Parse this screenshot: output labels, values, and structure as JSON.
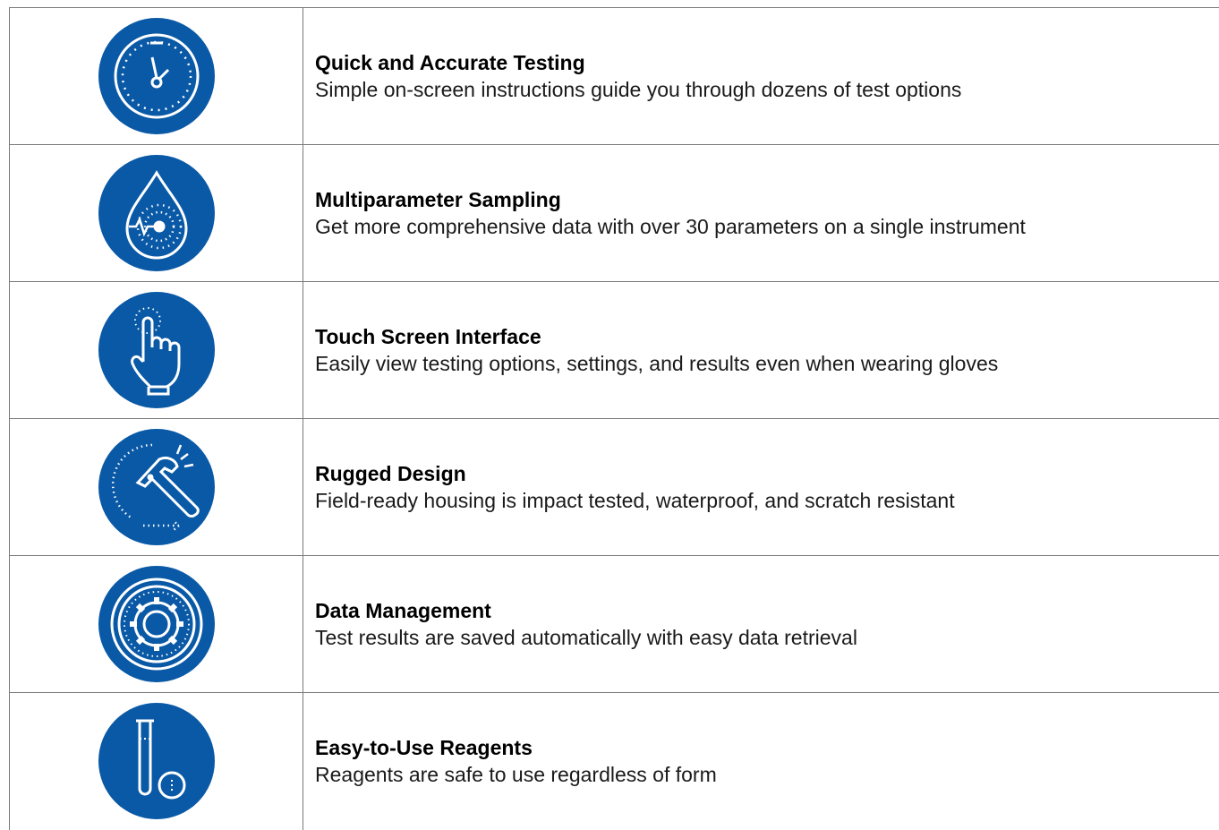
{
  "features": [
    {
      "icon": "stopwatch-icon",
      "title": "Quick and Accurate Testing",
      "description": "Simple on-screen instructions guide you through dozens of test options"
    },
    {
      "icon": "water-drop-icon",
      "title": "Multiparameter Sampling",
      "description": "Get more comprehensive data with over 30 parameters on a single instrument"
    },
    {
      "icon": "touch-hand-icon",
      "title": "Touch Screen Interface",
      "description": "Easily view testing options, settings, and results even when wearing gloves"
    },
    {
      "icon": "hammer-icon",
      "title": "Rugged Design",
      "description": "Field-ready housing is impact tested, waterproof, and scratch resistant"
    },
    {
      "icon": "gear-icon",
      "title": "Data Management",
      "description": "Test results are saved automatically with easy data retrieval"
    },
    {
      "icon": "test-tube-icon",
      "title": "Easy-to-Use Reagents",
      "description": "Reagents are safe to use regardless of form"
    }
  ],
  "colors": {
    "icon_background": "#0a59a6",
    "icon_stroke": "#ffffff",
    "border": "#7a7a7a"
  }
}
